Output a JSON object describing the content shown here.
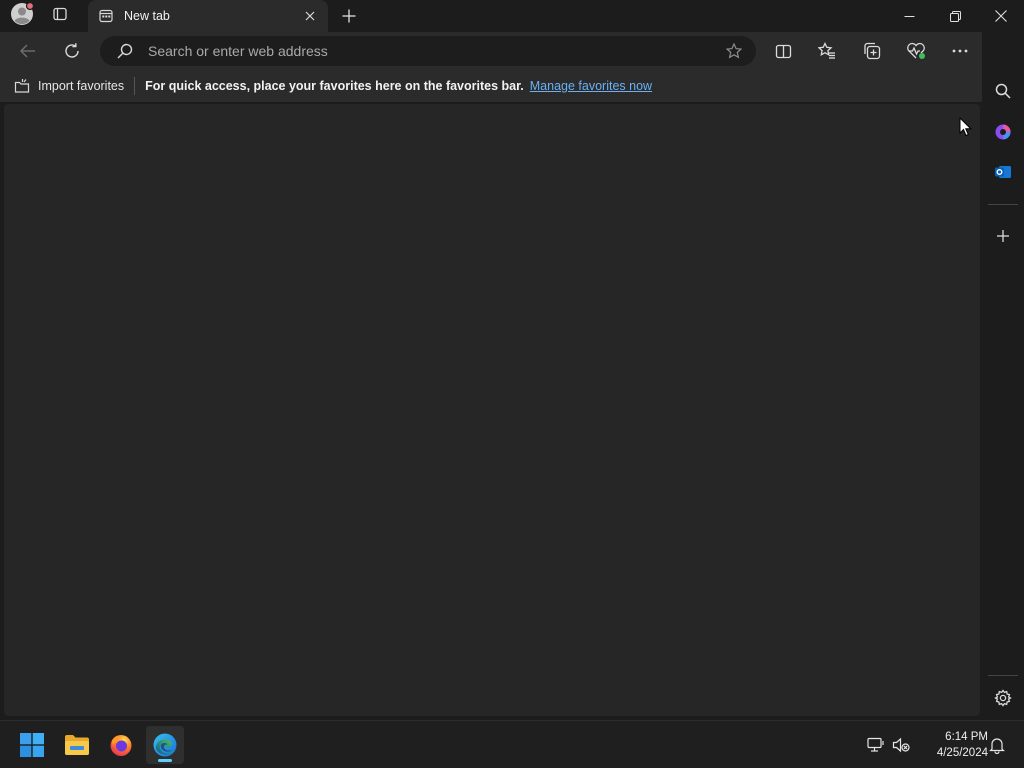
{
  "window": {
    "tab_title": "New tab"
  },
  "toolbar": {
    "address_placeholder": "Search or enter web address"
  },
  "favorites_bar": {
    "import_label": "Import favorites",
    "message": "For quick access, place your favorites here on the favorites bar.",
    "link": "Manage favorites now"
  },
  "taskbar": {
    "time": "6:14 PM",
    "date": "4/25/2024"
  },
  "icons": {
    "titlebar": [
      "profile-icon",
      "tab-actions-icon",
      "newtab-page-icon",
      "close-tab-icon",
      "plus-icon",
      "minimize-icon",
      "restore-icon",
      "close-icon"
    ],
    "toolbar": [
      "back-arrow-icon",
      "refresh-icon",
      "search-icon",
      "favorite-star-icon",
      "split-screen-icon",
      "favorites-icon",
      "collections-icon",
      "browser-essentials-icon",
      "more-icon",
      "copilot-icon"
    ],
    "sidebar": [
      "search-icon",
      "copilot-sidebar-icon",
      "outlook-icon",
      "add-icon",
      "settings-icon"
    ],
    "taskbar": [
      "windows-start-icon",
      "file-explorer-icon",
      "firefox-icon",
      "edge-icon",
      "network-icon",
      "volume-muted-icon",
      "notification-bell-icon"
    ]
  },
  "colors": {
    "accent_link": "#6ab0f3",
    "window_bg": "#1c1c1c",
    "content_bg": "#262626",
    "edge_active_indicator": "#60cdff"
  }
}
